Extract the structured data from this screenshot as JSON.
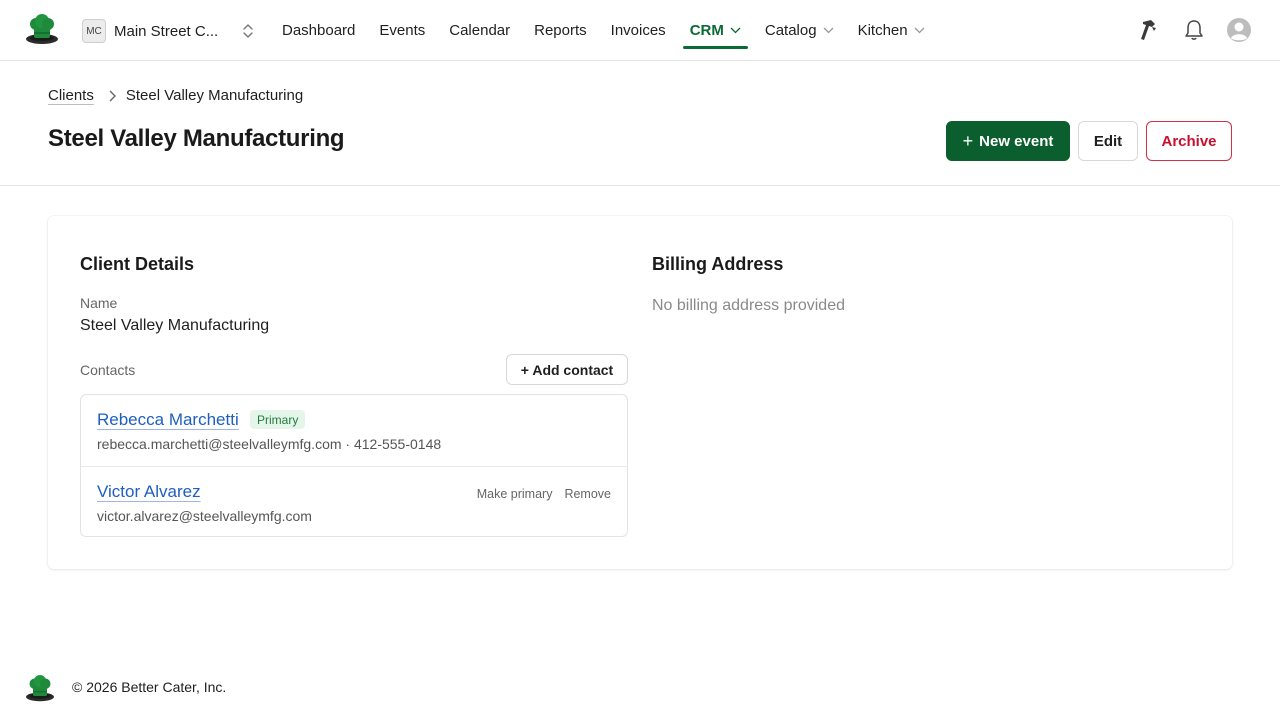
{
  "org": {
    "initials": "MC",
    "name": "Main Street C..."
  },
  "nav": {
    "items": [
      {
        "label": "Dashboard"
      },
      {
        "label": "Events"
      },
      {
        "label": "Calendar"
      },
      {
        "label": "Reports"
      },
      {
        "label": "Invoices"
      },
      {
        "label": "CRM",
        "active": true,
        "dropdown": true
      },
      {
        "label": "Catalog",
        "dropdown": true
      },
      {
        "label": "Kitchen",
        "dropdown": true
      }
    ],
    "icons": [
      "hammer-icon",
      "bell-icon",
      "avatar-icon"
    ]
  },
  "breadcrumb": {
    "parent": "Clients",
    "current": "Steel Valley Manufacturing"
  },
  "page": {
    "title": "Steel Valley Manufacturing"
  },
  "actions": {
    "new_event": "New event",
    "edit": "Edit",
    "archive": "Archive"
  },
  "client_details": {
    "title": "Client Details",
    "name_label": "Name",
    "name_value": "Steel Valley Manufacturing",
    "contacts_label": "Contacts",
    "add_contact": "+ Add contact",
    "contacts": [
      {
        "name": "Rebecca Marchetti",
        "badge": "Primary",
        "meta": "rebecca.marchetti@steelvalleymfg.com · 412-555-0148"
      },
      {
        "name": "Victor Alvarez",
        "meta": "victor.alvarez@steelvalleymfg.com",
        "make_primary": "Make primary",
        "remove": "Remove"
      }
    ]
  },
  "billing": {
    "title": "Billing Address",
    "empty": "No billing address provided"
  },
  "footer": {
    "copyright": "© 2026 Better Cater, Inc."
  },
  "colors": {
    "brand": "#0b5f2e",
    "active_nav": "#0b6b34",
    "link": "#1f5fbf",
    "danger": "#c8102e"
  }
}
